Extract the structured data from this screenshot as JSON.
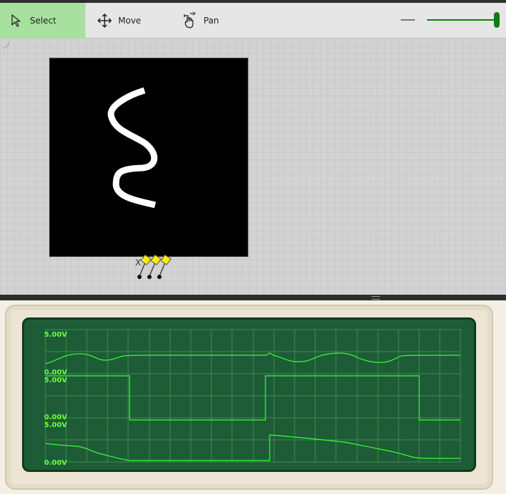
{
  "toolbar": {
    "select_label": "Select",
    "move_label": "Move",
    "pan_label": "Pan",
    "active_tool": "select",
    "zoom_level": 1.0,
    "accent_color": "#107c10",
    "select_highlight_color": "#a8e0a0"
  },
  "probe": {
    "label": "X"
  },
  "oscilloscope": {
    "channels": [
      {
        "top_label": "5.00V",
        "bottom_label": "0.00V"
      },
      {
        "top_label": "5.00V",
        "bottom_label": "0.00V"
      },
      {
        "top_label": "5.00V",
        "bottom_label": "0.00V"
      }
    ],
    "trace_color": "#33ff33",
    "screen_color": "#1e5c37"
  }
}
